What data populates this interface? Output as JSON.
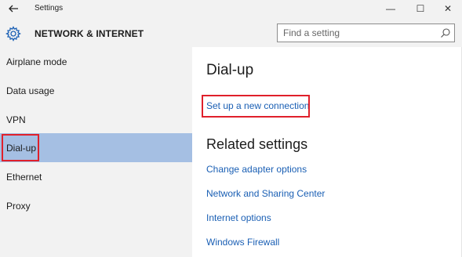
{
  "window": {
    "title": "Settings",
    "back_icon": "back-arrow-icon",
    "minimize_glyph": "—",
    "maximize_glyph": "☐",
    "close_glyph": "✕"
  },
  "header": {
    "icon": "gear-icon",
    "title": "NETWORK & INTERNET",
    "search_placeholder": "Find a setting"
  },
  "sidebar": {
    "items": [
      {
        "label": "Airplane mode",
        "selected": false
      },
      {
        "label": "Data usage",
        "selected": false
      },
      {
        "label": "VPN",
        "selected": false
      },
      {
        "label": "Dial-up",
        "selected": true
      },
      {
        "label": "Ethernet",
        "selected": false
      },
      {
        "label": "Proxy",
        "selected": false
      }
    ]
  },
  "main": {
    "title": "Dial-up",
    "setup_link": "Set up a new connection",
    "related_title": "Related settings",
    "related_links": [
      "Change adapter options",
      "Network and Sharing Center",
      "Internet options",
      "Windows Firewall"
    ]
  },
  "colors": {
    "accent_link": "#1a5fb4",
    "selected_bg": "#a5bfe3",
    "highlight_border": "#e0202b",
    "chrome_bg": "#f2f2f2"
  }
}
